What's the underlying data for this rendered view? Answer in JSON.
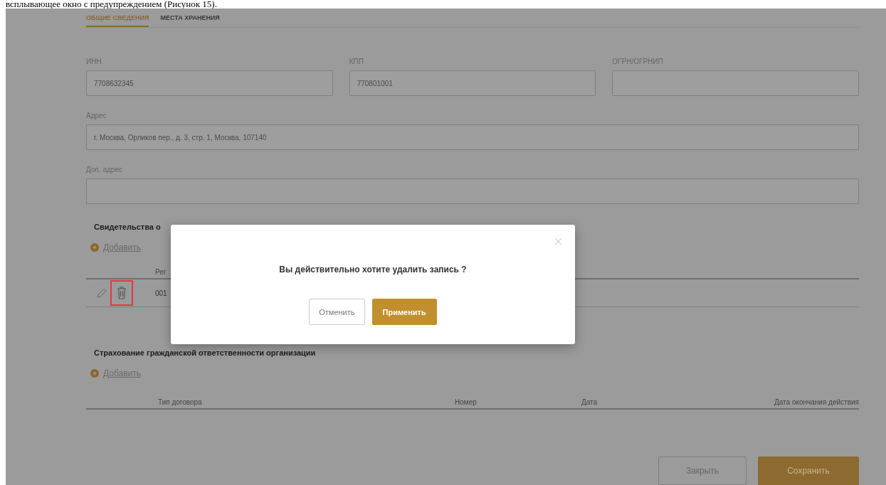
{
  "doc_caption": "всплывающее окно с предупреждением (Рисунок 15).",
  "tabs": [
    {
      "label": "ОБЩИЕ СВЕДЕНИЯ",
      "selected": true
    },
    {
      "label": "МЕСТА ХРАНЕНИЯ",
      "selected": false
    }
  ],
  "field_rows": [
    [
      {
        "label": "ИНН",
        "value": "7708632345"
      },
      {
        "label": "КПП",
        "value": "770801001"
      },
      {
        "label": "ОГРН/ОГРНИП"
      }
    ],
    [
      {
        "label": "Адрес",
        "value": "г. Москва, Орликов пер., д. 3, стр. 1, Москва, 107140"
      }
    ],
    [
      {
        "label": "Доп. адрес"
      }
    ]
  ],
  "sections": [
    {
      "title": "Свидетельства о",
      "add_link": "Добавить",
      "columns": [
        "Рег"
      ],
      "rows": [
        {
          "cells": [
            "001"
          ],
          "delete_highlighted": true
        }
      ]
    },
    {
      "title": "Страхование гражданской ответственности организации",
      "add_link": "Добавить",
      "columns": [
        "Тип договора",
        "Номер",
        "Дата",
        "Дата окончания действия"
      ]
    }
  ],
  "footer_buttons": [
    {
      "label": "Закрыть",
      "kind": "secondary"
    },
    {
      "label": "Сохранить",
      "kind": "primary"
    }
  ],
  "dialog": {
    "message": "Вы действительно хотите удалить запись ?",
    "buttons": [
      {
        "label": "Отменить",
        "kind": "secondary"
      },
      {
        "label": "Применить",
        "kind": "primary"
      }
    ]
  }
}
